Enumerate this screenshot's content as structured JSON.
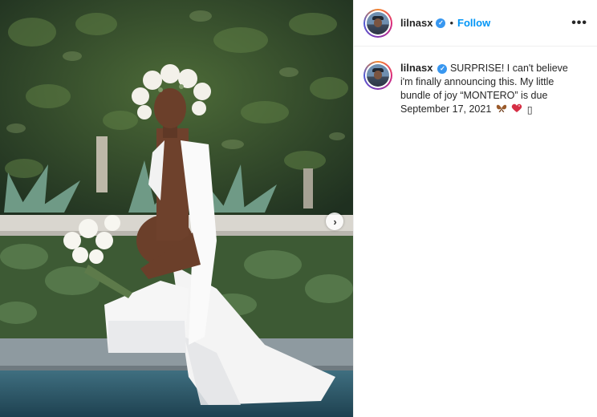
{
  "post": {
    "username": "lilnasx",
    "follow_label": "Follow",
    "dot": "•",
    "more_label": "•••",
    "verified_glyph": "✓",
    "caption": "SURPRISE! I can't believe i'm finally announcing this. My little bundle of joy “MONTERO” is due September 17, 2021",
    "emoji_icons": [
      "butterfly-icon",
      "red-heart-icon",
      "unknown-glyph-icon"
    ],
    "emoji_tail": "▯",
    "next_label": "›"
  },
  "colors": {
    "follow_blue": "#0095f6",
    "verified_blue": "#3897f0",
    "text": "#262626"
  }
}
